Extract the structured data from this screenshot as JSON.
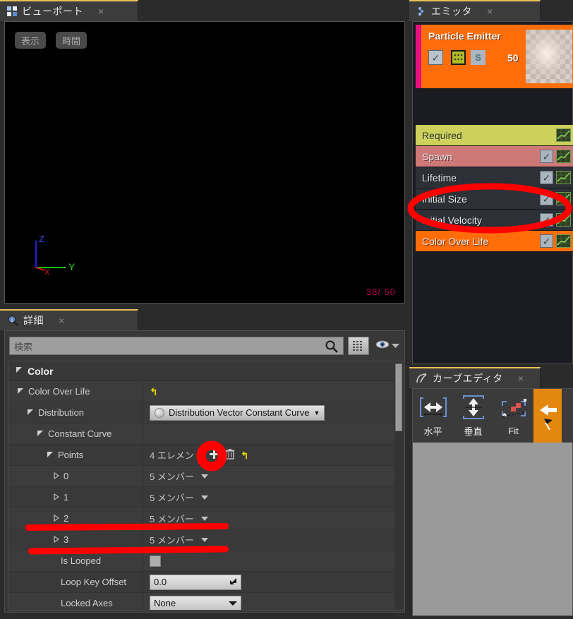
{
  "viewport": {
    "tab_label": "ビューポート",
    "tab_icon": "grid-icon",
    "close_label": "×",
    "buttons": [
      {
        "label": "表示",
        "name": "viewport-show-button"
      },
      {
        "label": "時間",
        "name": "viewport-time-button"
      }
    ],
    "particle_counter": "38/ 50",
    "axes": {
      "x": "X",
      "y": "Y",
      "z": "Z"
    }
  },
  "details": {
    "tab_label": "詳細",
    "tab_icon": "info-magnifier-icon",
    "close_label": "×",
    "search": {
      "placeholder": "検索",
      "value": ""
    },
    "category": "Color",
    "rows": [
      {
        "name": "Color Over Life",
        "indent": 1,
        "expander": "open",
        "value_type": "reset",
        "reset": "↰"
      },
      {
        "name": "Distribution",
        "indent": 2,
        "expander": "open",
        "value_type": "combo",
        "value": "Distribution Vector Constant Curve"
      },
      {
        "name": "Constant Curve",
        "indent": 3,
        "expander": "open",
        "value_type": "none",
        "value": ""
      },
      {
        "name": "Points",
        "indent": 4,
        "expander": "open",
        "value_type": "array",
        "value": "4 エレメント",
        "add": "+",
        "delete": "🗑",
        "reset": "↰"
      },
      {
        "name": "0",
        "indent": 5,
        "expander": "closed",
        "value_type": "members",
        "value": "5 メンバー"
      },
      {
        "name": "1",
        "indent": 5,
        "expander": "closed",
        "value_type": "members",
        "value": "5 メンバー"
      },
      {
        "name": "2",
        "indent": 5,
        "expander": "closed",
        "value_type": "members",
        "value": "5 メンバー"
      },
      {
        "name": "3",
        "indent": 5,
        "expander": "closed",
        "value_type": "members",
        "value": "5 メンバー"
      },
      {
        "name": "Is Looped",
        "indent": 5,
        "expander": "none",
        "value_type": "checkbox",
        "value": ""
      },
      {
        "name": "Loop Key Offset",
        "indent": 5,
        "expander": "none",
        "value_type": "text",
        "value": "0.0"
      },
      {
        "name": "Locked Axes",
        "indent": 5,
        "expander": "none",
        "value_type": "select",
        "value": "None"
      }
    ]
  },
  "emitter": {
    "tab_label": "エミッタ",
    "tab_icon": "emitter-icon",
    "close_label": "×",
    "title": "Particle Emitter",
    "count": "50",
    "enabled_checkbox": "✓",
    "solo_label": "S",
    "accent_color": "#ff6d0a",
    "stripe_color": "#e8107f",
    "modules": [
      {
        "label": "Required",
        "bg": "#cdd05a",
        "text": "#2c2c20",
        "has_checkbox": false,
        "has_graph": true,
        "selected": false
      },
      {
        "label": "Spawn",
        "bg": "#cf7878",
        "text": "#f4eaea",
        "has_checkbox": true,
        "has_graph": true,
        "selected": false
      },
      {
        "label": "Lifetime",
        "bg": "#2e3038",
        "text": "#e9e9e9",
        "has_checkbox": true,
        "has_graph": true,
        "selected": false
      },
      {
        "label": "Initial Size",
        "bg": "#2e3038",
        "text": "#e9e9e9",
        "has_checkbox": true,
        "has_graph": true,
        "selected": false
      },
      {
        "label": "Initial Velocity",
        "bg": "#2e3038",
        "text": "#e9e9e9",
        "has_checkbox": true,
        "has_graph": true,
        "selected": false
      },
      {
        "label": "Color Over Life",
        "bg": "#ff6d0a",
        "text": "#ffffff",
        "has_checkbox": true,
        "has_graph": true,
        "selected": true
      }
    ]
  },
  "curve_editor": {
    "tab_label": "カーブエディタ",
    "tab_icon": "curve-icon",
    "close_label": "×",
    "buttons": [
      {
        "label": "水平",
        "name": "curve-fit-horizontal-button",
        "icon": "horizontal-arrows-icon",
        "active": false
      },
      {
        "label": "垂直",
        "name": "curve-fit-vertical-button",
        "icon": "vertical-arrows-icon",
        "active": false
      },
      {
        "label": "Fit",
        "name": "curve-fit-button",
        "icon": "fit-selection-icon",
        "active": false
      },
      {
        "label": "",
        "name": "curve-pan-button",
        "icon": "left-arrow-icon",
        "active": true
      }
    ]
  },
  "annotations": {
    "circle_target": "Color Over Life module",
    "plus_target": "Points add element button",
    "underline_targets": [
      "Points element 2",
      "Points element 3"
    ],
    "color": "#ff0000"
  }
}
